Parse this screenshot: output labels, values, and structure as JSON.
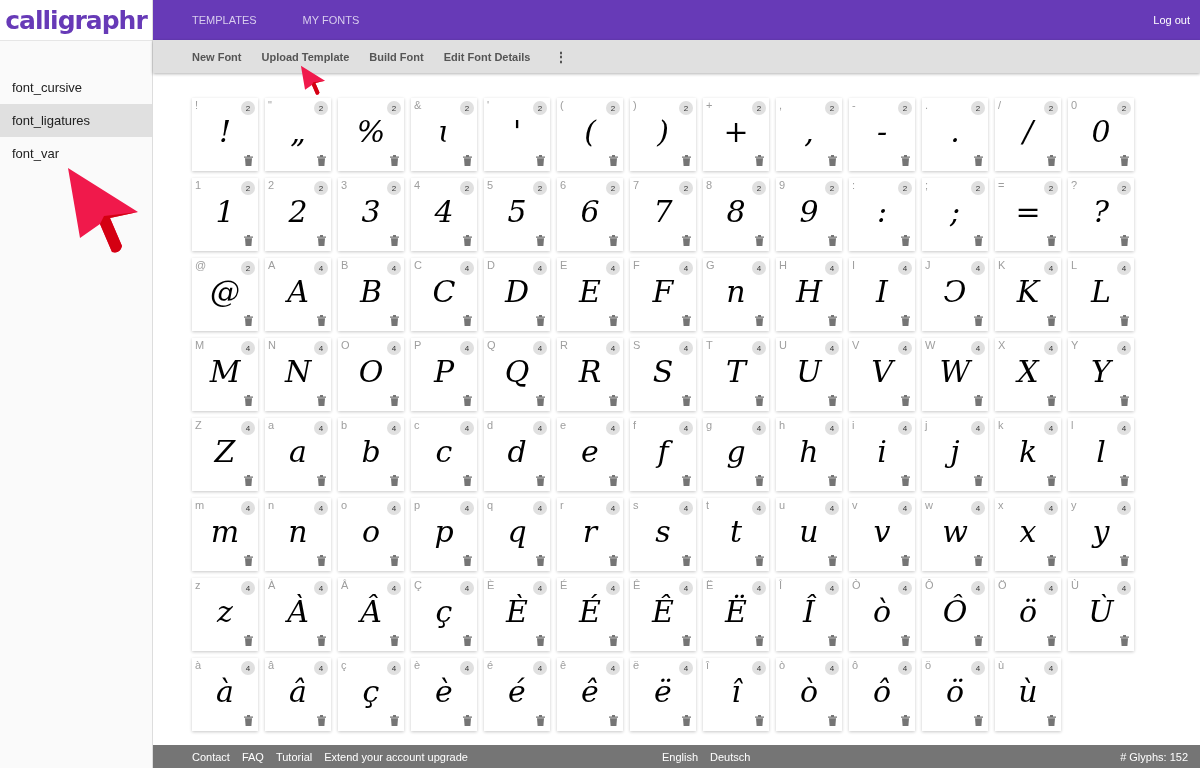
{
  "logo": "calligraphr",
  "top_nav": [
    {
      "label": "TEMPLATES"
    },
    {
      "label": "MY FONTS"
    }
  ],
  "logout": "Log out",
  "toolbar": [
    {
      "label": "New Font"
    },
    {
      "label": "Upload Template"
    },
    {
      "label": "Build Font"
    },
    {
      "label": "Edit Font Details"
    }
  ],
  "more_menu": "⋮",
  "fonts": [
    {
      "name": "font_cursive",
      "selected": false
    },
    {
      "name": "font_ligatures",
      "selected": true
    },
    {
      "name": "font_var",
      "selected": false
    }
  ],
  "glyphs": [
    {
      "label": "!",
      "count": "2",
      "drawn": "!"
    },
    {
      "label": "\"",
      "count": "2",
      "drawn": "„"
    },
    {
      "count": "2",
      "drawn": "%"
    },
    {
      "label": "&",
      "count": "2",
      "drawn": "ɩ"
    },
    {
      "label": "'",
      "count": "2",
      "drawn": "'"
    },
    {
      "label": "(",
      "count": "2",
      "drawn": "("
    },
    {
      "label": ")",
      "count": "2",
      "drawn": ")"
    },
    {
      "label": "+",
      "count": "2",
      "drawn": "+"
    },
    {
      "label": ",",
      "count": "2",
      "drawn": ","
    },
    {
      "label": "-",
      "count": "2",
      "drawn": "-"
    },
    {
      "label": ".",
      "count": "2",
      "drawn": "."
    },
    {
      "label": "/",
      "count": "2",
      "drawn": "/"
    },
    {
      "label": "0",
      "count": "2",
      "drawn": "0"
    },
    {
      "label": "1",
      "count": "2",
      "drawn": "1"
    },
    {
      "label": "2",
      "count": "2",
      "drawn": "2"
    },
    {
      "label": "3",
      "count": "2",
      "drawn": "3"
    },
    {
      "label": "4",
      "count": "2",
      "drawn": "4"
    },
    {
      "label": "5",
      "count": "2",
      "drawn": "5"
    },
    {
      "label": "6",
      "count": "2",
      "drawn": "6"
    },
    {
      "label": "7",
      "count": "2",
      "drawn": "7"
    },
    {
      "label": "8",
      "count": "2",
      "drawn": "8"
    },
    {
      "label": "9",
      "count": "2",
      "drawn": "9"
    },
    {
      "label": ":",
      "count": "2",
      "drawn": ":"
    },
    {
      "label": ";",
      "count": "2",
      "drawn": ";"
    },
    {
      "label": "=",
      "count": "2",
      "drawn": "="
    },
    {
      "label": "?",
      "count": "2",
      "drawn": "?"
    },
    {
      "label": "@",
      "count": "2",
      "drawn": "@"
    },
    {
      "label": "A",
      "count": "4",
      "drawn": "A"
    },
    {
      "label": "B",
      "count": "4",
      "drawn": "B"
    },
    {
      "label": "C",
      "count": "4",
      "drawn": "C"
    },
    {
      "label": "D",
      "count": "4",
      "drawn": "D"
    },
    {
      "label": "E",
      "count": "4",
      "drawn": "E"
    },
    {
      "label": "F",
      "count": "4",
      "drawn": "F"
    },
    {
      "label": "G",
      "count": "4",
      "drawn": "n"
    },
    {
      "label": "H",
      "count": "4",
      "drawn": "H"
    },
    {
      "label": "I",
      "count": "4",
      "drawn": "I"
    },
    {
      "label": "J",
      "count": "4",
      "drawn": "Ↄ"
    },
    {
      "label": "K",
      "count": "4",
      "drawn": "K"
    },
    {
      "label": "L",
      "count": "4",
      "drawn": "L"
    },
    {
      "label": "M",
      "count": "4",
      "drawn": "M"
    },
    {
      "label": "N",
      "count": "4",
      "drawn": "N"
    },
    {
      "label": "O",
      "count": "4",
      "drawn": "O"
    },
    {
      "label": "P",
      "count": "4",
      "drawn": "P"
    },
    {
      "label": "Q",
      "count": "4",
      "drawn": "Q"
    },
    {
      "label": "R",
      "count": "4",
      "drawn": "R"
    },
    {
      "label": "S",
      "count": "4",
      "drawn": "S"
    },
    {
      "label": "T",
      "count": "4",
      "drawn": "T"
    },
    {
      "label": "U",
      "count": "4",
      "drawn": "U"
    },
    {
      "label": "V",
      "count": "4",
      "drawn": "V"
    },
    {
      "label": "W",
      "count": "4",
      "drawn": "W"
    },
    {
      "label": "X",
      "count": "4",
      "drawn": "X"
    },
    {
      "label": "Y",
      "count": "4",
      "drawn": "Y"
    },
    {
      "label": "Z",
      "count": "4",
      "drawn": "Z"
    },
    {
      "label": "a",
      "count": "4",
      "drawn": "a"
    },
    {
      "label": "b",
      "count": "4",
      "drawn": "b"
    },
    {
      "label": "c",
      "count": "4",
      "drawn": "c"
    },
    {
      "label": "d",
      "count": "4",
      "drawn": "d"
    },
    {
      "label": "e",
      "count": "4",
      "drawn": "e"
    },
    {
      "label": "f",
      "count": "4",
      "drawn": "f"
    },
    {
      "label": "g",
      "count": "4",
      "drawn": "g"
    },
    {
      "label": "h",
      "count": "4",
      "drawn": "h"
    },
    {
      "label": "i",
      "count": "4",
      "drawn": "i"
    },
    {
      "label": "j",
      "count": "4",
      "drawn": "j"
    },
    {
      "label": "k",
      "count": "4",
      "drawn": "k"
    },
    {
      "label": "l",
      "count": "4",
      "drawn": "l"
    },
    {
      "label": "m",
      "count": "4",
      "drawn": "m"
    },
    {
      "label": "n",
      "count": "4",
      "drawn": "n"
    },
    {
      "label": "o",
      "count": "4",
      "drawn": "o"
    },
    {
      "label": "p",
      "count": "4",
      "drawn": "p"
    },
    {
      "label": "q",
      "count": "4",
      "drawn": "q"
    },
    {
      "label": "r",
      "count": "4",
      "drawn": "r"
    },
    {
      "label": "s",
      "count": "4",
      "drawn": "s"
    },
    {
      "label": "t",
      "count": "4",
      "drawn": "t"
    },
    {
      "label": "u",
      "count": "4",
      "drawn": "u"
    },
    {
      "label": "v",
      "count": "4",
      "drawn": "v"
    },
    {
      "label": "w",
      "count": "4",
      "drawn": "w"
    },
    {
      "label": "x",
      "count": "4",
      "drawn": "x"
    },
    {
      "label": "y",
      "count": "4",
      "drawn": "y"
    },
    {
      "label": "z",
      "count": "4",
      "drawn": "z"
    },
    {
      "label": "À",
      "count": "4",
      "drawn": "À"
    },
    {
      "label": "Â",
      "count": "4",
      "drawn": "Â"
    },
    {
      "label": "Ç",
      "count": "4",
      "drawn": "ç"
    },
    {
      "label": "È",
      "count": "4",
      "drawn": "È"
    },
    {
      "label": "É",
      "count": "4",
      "drawn": "É"
    },
    {
      "label": "Ê",
      "count": "4",
      "drawn": "Ê"
    },
    {
      "label": "Ë",
      "count": "4",
      "drawn": "Ë"
    },
    {
      "label": "Î",
      "count": "4",
      "drawn": "Î"
    },
    {
      "label": "Ò",
      "count": "4",
      "drawn": "ò"
    },
    {
      "label": "Ô",
      "count": "4",
      "drawn": "Ô"
    },
    {
      "label": "Ö",
      "count": "4",
      "drawn": "ö"
    },
    {
      "label": "Ù",
      "count": "4",
      "drawn": "Ù"
    },
    {
      "label": "à",
      "count": "4",
      "drawn": "à"
    },
    {
      "label": "â",
      "count": "4",
      "drawn": "â"
    },
    {
      "label": "ç",
      "count": "4",
      "drawn": "ç"
    },
    {
      "label": "è",
      "count": "4",
      "drawn": "è"
    },
    {
      "label": "é",
      "count": "4",
      "drawn": "é"
    },
    {
      "label": "ê",
      "count": "4",
      "drawn": "ê"
    },
    {
      "label": "ë",
      "count": "4",
      "drawn": "ë"
    },
    {
      "label": "î",
      "count": "4",
      "drawn": "î"
    },
    {
      "label": "ò",
      "count": "4",
      "drawn": "ò"
    },
    {
      "label": "ô",
      "count": "4",
      "drawn": "ô"
    },
    {
      "label": "ö",
      "count": "4",
      "drawn": "ö"
    },
    {
      "label": "ù",
      "count": "4",
      "drawn": "ù"
    }
  ],
  "footer_links": [
    {
      "label": "Contact"
    },
    {
      "label": "FAQ"
    },
    {
      "label": "Tutorial"
    },
    {
      "label": "Extend your account upgrade"
    }
  ],
  "languages": [
    {
      "label": "English"
    },
    {
      "label": "Deutsch"
    }
  ],
  "glyph_count": "# Glyphs: 152"
}
